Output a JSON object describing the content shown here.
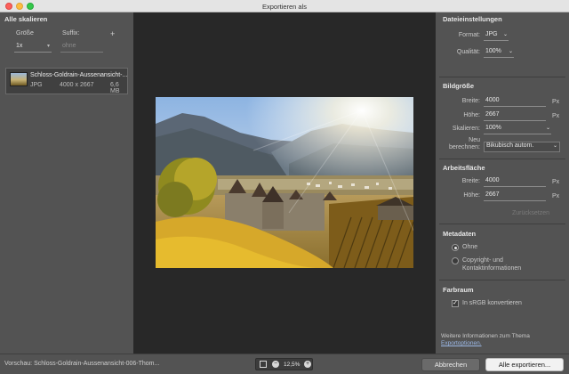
{
  "window": {
    "title": "Exportieren als"
  },
  "left": {
    "header": "Alle skalieren",
    "size_label": "Größe",
    "suffix_label": "Suffix:",
    "size_value": "1x",
    "suffix_placeholder": "ohne",
    "asset": {
      "name": "Schloss-Goldrain-Aussenansicht-...",
      "format": "JPG",
      "dimensions": "4000 x 2667",
      "filesize": "6,6 MB"
    }
  },
  "right": {
    "file_settings": {
      "title": "Dateieinstellungen",
      "format_label": "Format:",
      "format_value": "JPG",
      "quality_label": "Qualität:",
      "quality_value": "100%"
    },
    "image_size": {
      "title": "Bildgröße",
      "width_label": "Breite:",
      "width_value": "4000",
      "height_label": "Höhe:",
      "height_value": "2667",
      "scale_label": "Skalieren:",
      "scale_value": "100%",
      "resample_label_1": "Neu",
      "resample_label_2": "berechnen:",
      "resample_value": "Bikubisch autom.",
      "unit": "Px"
    },
    "canvas": {
      "title": "Arbeitsfläche",
      "width_label": "Breite:",
      "width_value": "4000",
      "height_label": "Höhe:",
      "height_value": "2667",
      "unit": "Px",
      "reset_label": "Zurücksetzen"
    },
    "metadata": {
      "title": "Metadaten",
      "option_none": "Ohne",
      "option_copyright_1": "Copyright- und",
      "option_copyright_2": "Kontaktinformationen"
    },
    "colorspace": {
      "title": "Farbraum",
      "srgb_label": "In sRGB konvertieren"
    },
    "more_info": {
      "text": "Weitere Informationen zum Thema",
      "link": "Exportoptionen."
    }
  },
  "footer": {
    "preview_text": "Vorschau: Schloss-Goldrain-Aussenansicht-006-Thom...",
    "zoom_value": "12,5%",
    "cancel_label": "Abbrechen",
    "export_label": "Alle exportieren..."
  }
}
